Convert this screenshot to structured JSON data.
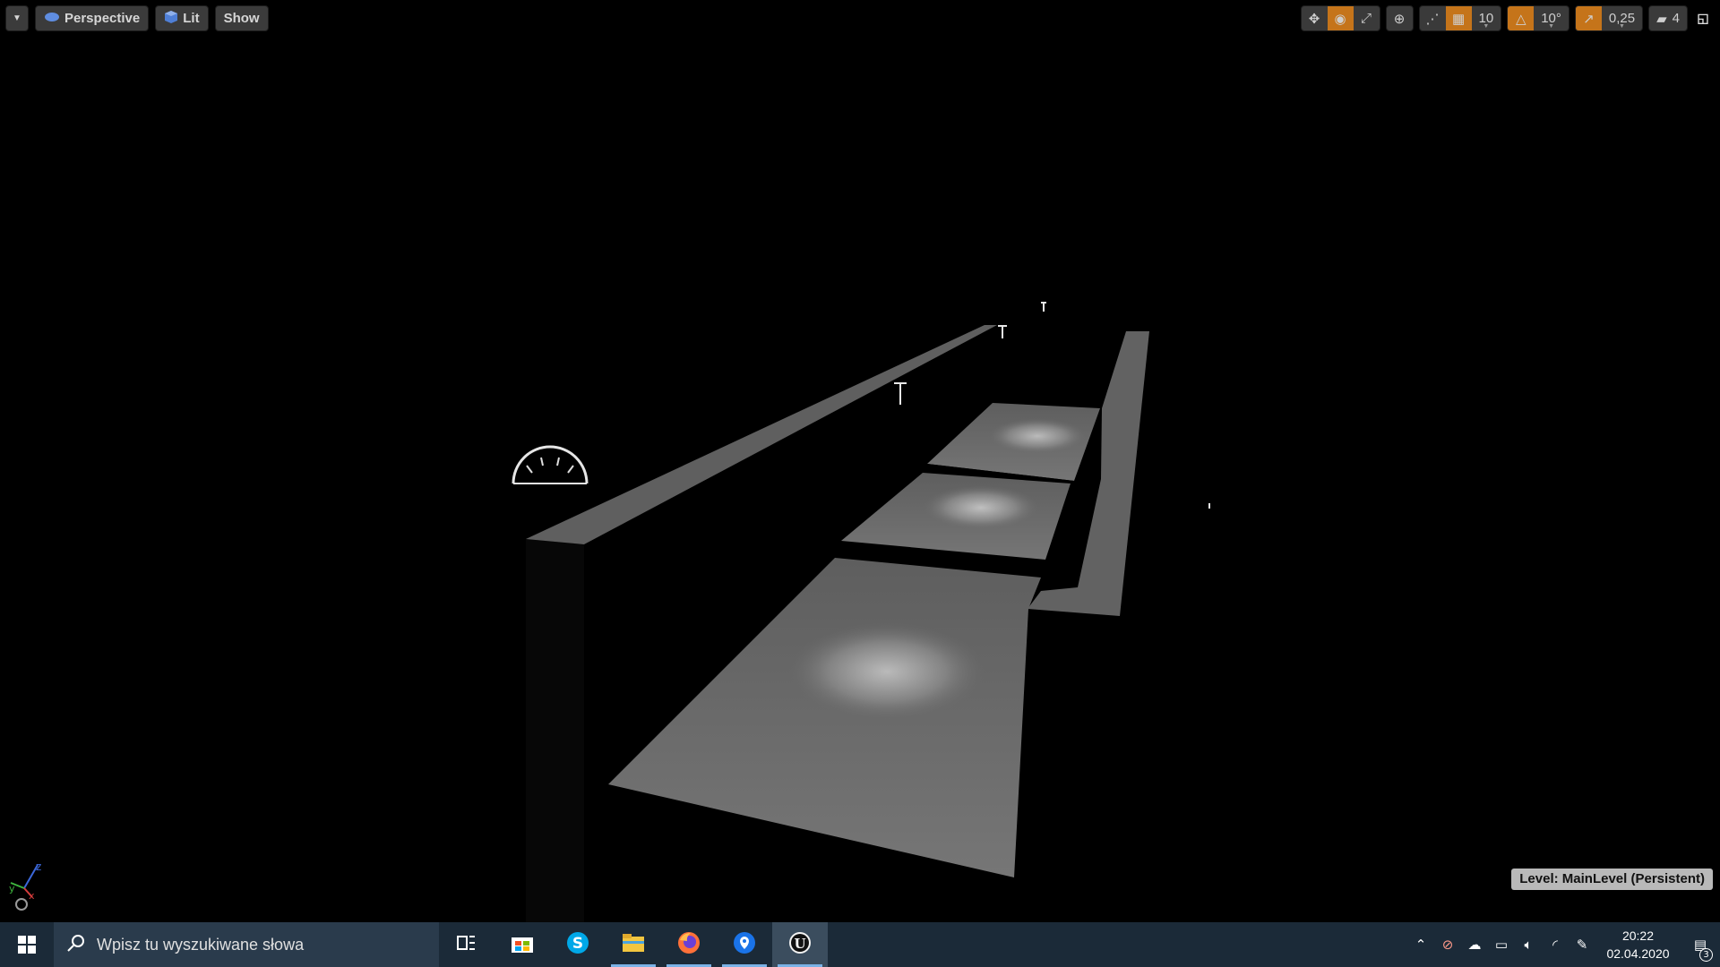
{
  "viewport": {
    "menu_icon": "chevron-down-icon",
    "perspective_label": "Perspective",
    "lit_label": "Lit",
    "show_label": "Show",
    "grid_snap_value": "10",
    "rotation_snap_value": "10°",
    "scale_snap_value": "0,25",
    "camera_speed_value": "4",
    "level_label": "Level:  MainLevel (Persistent)",
    "accent_color": "#c5741a"
  },
  "taskbar": {
    "search_placeholder": "Wpisz tu wyszukiwane słowa",
    "time": "20:22",
    "date": "02.04.2020",
    "notification_count": "3",
    "apps": [
      "task-view-icon",
      "store-icon",
      "skype-icon",
      "file-explorer-icon",
      "firefox-icon",
      "maps-icon",
      "unreal-engine-icon"
    ]
  }
}
